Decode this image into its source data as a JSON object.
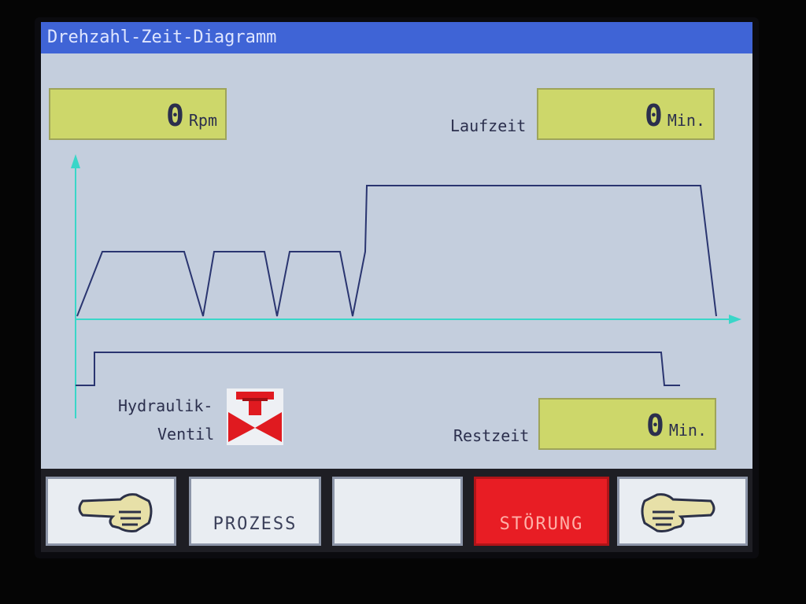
{
  "window": {
    "title": "Drehzahl-Zeit-Diagramm"
  },
  "speed": {
    "value": "0",
    "unit": "Rpm"
  },
  "runtime": {
    "label": "Laufzeit",
    "value": "0",
    "unit": "Min."
  },
  "remaining": {
    "label": "Restzeit",
    "value": "0",
    "unit": "Min."
  },
  "valve": {
    "label_line1": "Hydraulik-",
    "label_line2": "Ventil",
    "icon": "hydraulic-valve-icon",
    "color": "#e01a20"
  },
  "buttons": {
    "left_icon": "hand-pointing-left-icon",
    "process_label": "PROZESS",
    "empty_label": "",
    "fault_label": "STÖRUNG",
    "right_icon": "hand-pointing-right-icon"
  },
  "colors": {
    "title_bar": "#3f64d6",
    "screen_bg": "#c4cedd",
    "value_box": "#cdd76a",
    "axis": "#3ad6c8",
    "curve": "#2a3570",
    "fault": "#e81d24"
  }
}
